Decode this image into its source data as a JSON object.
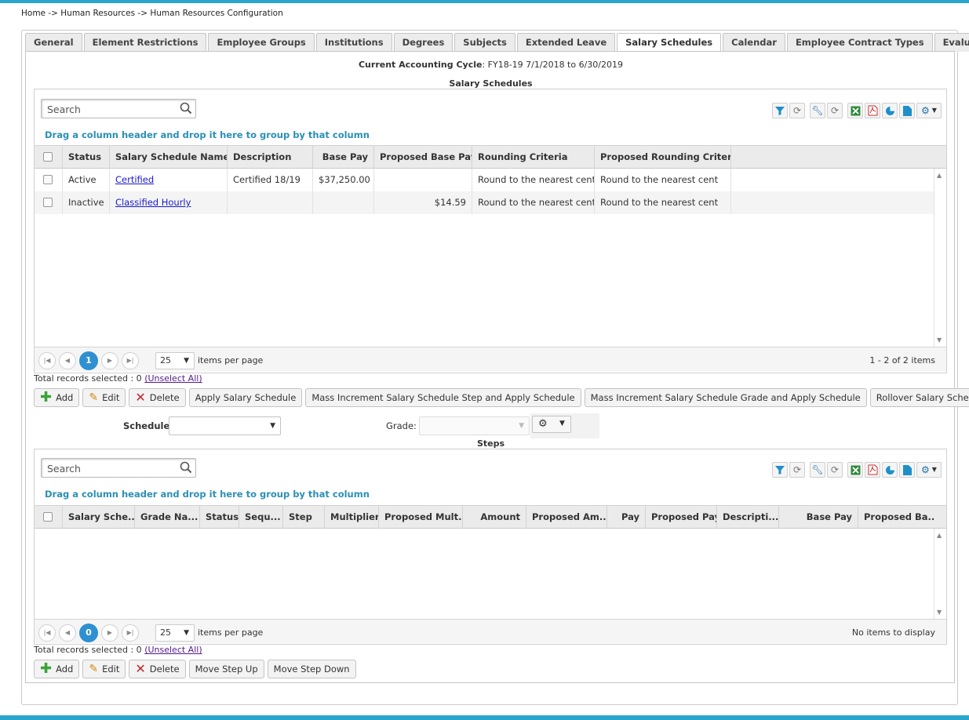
{
  "breadcrumb": "Home -> Human Resources -> Human Resources Configuration",
  "tabs": [
    {
      "label": "General"
    },
    {
      "label": "Element Restrictions"
    },
    {
      "label": "Employee Groups"
    },
    {
      "label": "Institutions"
    },
    {
      "label": "Degrees"
    },
    {
      "label": "Subjects"
    },
    {
      "label": "Extended Leave"
    },
    {
      "label": "Salary Schedules",
      "active": true
    },
    {
      "label": "Calendar"
    },
    {
      "label": "Employee Contract Types"
    },
    {
      "label": "Evaluator"
    }
  ],
  "cycle": {
    "label": "Current Accounting Cycle",
    "value": ": FY18-19 7/1/2018 to 6/30/2019"
  },
  "schedules": {
    "title": "Salary Schedules",
    "search_placeholder": "Search",
    "group_hint": "Drag a column header and drop it here to group by that column",
    "columns": [
      "Status",
      "Salary Schedule Name",
      "Description",
      "Base Pay",
      "Proposed Base Pay",
      "Rounding Criteria",
      "Proposed Rounding Criteria"
    ],
    "sort_indicator": "↑",
    "rows": [
      {
        "status": "Active",
        "name": "Certified",
        "description": "Certified 18/19",
        "base_pay": "$37,250.00",
        "proposed_base_pay": "",
        "rounding": "Round to the nearest cent",
        "proposed_rounding": "Round to the nearest cent"
      },
      {
        "status": "Inactive",
        "name": "Classified Hourly",
        "description": "",
        "base_pay": "",
        "proposed_base_pay": "$14.59",
        "rounding": "Round to the nearest cent",
        "proposed_rounding": "Round to the nearest cent"
      }
    ],
    "pager": {
      "page": "1",
      "page_size": "25",
      "label": "items per page",
      "info": "1 - 2 of 2 items"
    },
    "totals": {
      "text": "Total records selected : 0",
      "link": "(Unselect All)"
    },
    "buttons": {
      "add": "Add",
      "edit": "Edit",
      "delete": "Delete",
      "apply": "Apply Salary Schedule",
      "mass_step": "Mass Increment Salary Schedule Step and Apply Schedule",
      "mass_grade": "Mass Increment Salary Schedule Grade and Apply Schedule",
      "rollover": "Rollover Salary Schedules"
    }
  },
  "filters": {
    "schedule_label": "Schedule:",
    "schedule_value": "",
    "grade_label": "Grade:",
    "grade_value": ""
  },
  "steps": {
    "title": "Steps",
    "search_placeholder": "Search",
    "group_hint": "Drag a column header and drop it here to group by that column",
    "columns": [
      "Salary Sche...",
      "Grade Na...",
      "Status",
      "Sequ...",
      "Step",
      "Multiplier",
      "Proposed Mult...",
      "Amount",
      "Proposed Am...",
      "Pay",
      "Proposed Pay",
      "Descripti...",
      "Base Pay",
      "Proposed Ba..."
    ],
    "pager": {
      "page": "0",
      "page_size": "25",
      "label": "items per page",
      "info": "No items to display"
    },
    "totals": {
      "text": "Total records selected : 0",
      "link": "(Unselect All)"
    },
    "buttons": {
      "add": "Add",
      "edit": "Edit",
      "delete": "Delete",
      "step_up": "Move Step Up",
      "step_down": "Move Step Down"
    }
  },
  "icons": {
    "filter": "filter-icon",
    "refresh": "refresh-icon",
    "wrench": "wrench-icon",
    "excel": "excel-icon",
    "pdf": "pdf-icon",
    "chart": "pie-chart-icon",
    "document": "document-icon",
    "settings": "gear-icon"
  },
  "colors": {
    "accent": "#2aa6cc",
    "link": "#1a1acc",
    "hint": "#2b8fb5",
    "page_current": "#2e90d1"
  }
}
